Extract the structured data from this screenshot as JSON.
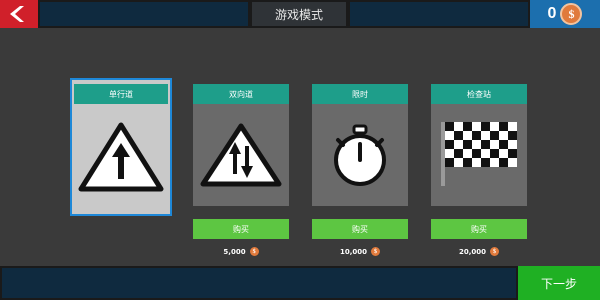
{
  "header": {
    "title": "游戏模式",
    "coins": "0",
    "coin_symbol": "$"
  },
  "modes": [
    {
      "title": "单行道",
      "icon": "one-way-arrow-icon",
      "selected": true
    },
    {
      "title": "双向道",
      "icon": "two-way-arrow-icon",
      "buy_label": "购买",
      "price": "5,000"
    },
    {
      "title": "限时",
      "icon": "stopwatch-icon",
      "buy_label": "购买",
      "price": "10,000"
    },
    {
      "title": "检查站",
      "icon": "checkered-flag-icon",
      "buy_label": "购买",
      "price": "20,000"
    }
  ],
  "footer": {
    "next_label": "下一步"
  },
  "colors": {
    "back": "#d0202a",
    "title_bar": "#1e9e8a",
    "buy": "#5dc642",
    "next": "#1fb023",
    "coins_panel": "#1c6fae",
    "selection": "#1e88d8"
  }
}
